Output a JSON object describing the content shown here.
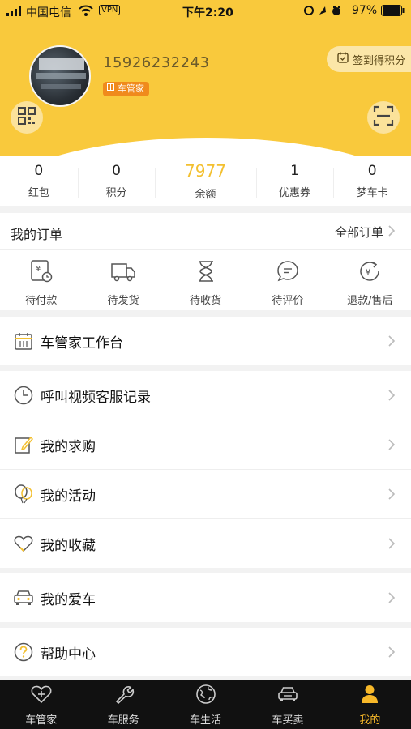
{
  "status_bar": {
    "carrier": "中国电信",
    "vpn": "VPN",
    "time": "下午2:20",
    "battery": "97%"
  },
  "profile": {
    "phone": "15926232243",
    "role_badge": "车管家",
    "signin_label": "签到得积分"
  },
  "stats": [
    {
      "value": "0",
      "label": "红包"
    },
    {
      "value": "0",
      "label": "积分"
    },
    {
      "value": "7977",
      "label": "余额"
    },
    {
      "value": "1",
      "label": "优惠券"
    },
    {
      "value": "0",
      "label": "梦车卡"
    }
  ],
  "orders": {
    "title": "我的订单",
    "all_label": "全部订单",
    "items": [
      {
        "label": "待付款",
        "icon": "payment-pending-icon"
      },
      {
        "label": "待发货",
        "icon": "truck-icon"
      },
      {
        "label": "待收货",
        "icon": "hourglass-icon"
      },
      {
        "label": "待评价",
        "icon": "comment-icon"
      },
      {
        "label": "退款/售后",
        "icon": "refund-icon"
      }
    ]
  },
  "menu": {
    "workbench": "车管家工作台",
    "video_service": "呼叫视频客服记录",
    "my_requests": "我的求购",
    "my_activities": "我的活动",
    "my_favorites": "我的收藏",
    "my_car": "我的爱车",
    "help_center": "帮助中心"
  },
  "tabbar": [
    {
      "label": "车管家",
      "icon": "heart-plus-icon"
    },
    {
      "label": "车服务",
      "icon": "wrench-icon"
    },
    {
      "label": "车生活",
      "icon": "globe-icon"
    },
    {
      "label": "车买卖",
      "icon": "car-icon"
    },
    {
      "label": "我的",
      "icon": "user-icon"
    }
  ],
  "colors": {
    "brand_yellow": "#f9c93c",
    "accent_gold": "#f3c030",
    "badge_orange": "#f08a1c",
    "tab_active": "#f7b829"
  }
}
